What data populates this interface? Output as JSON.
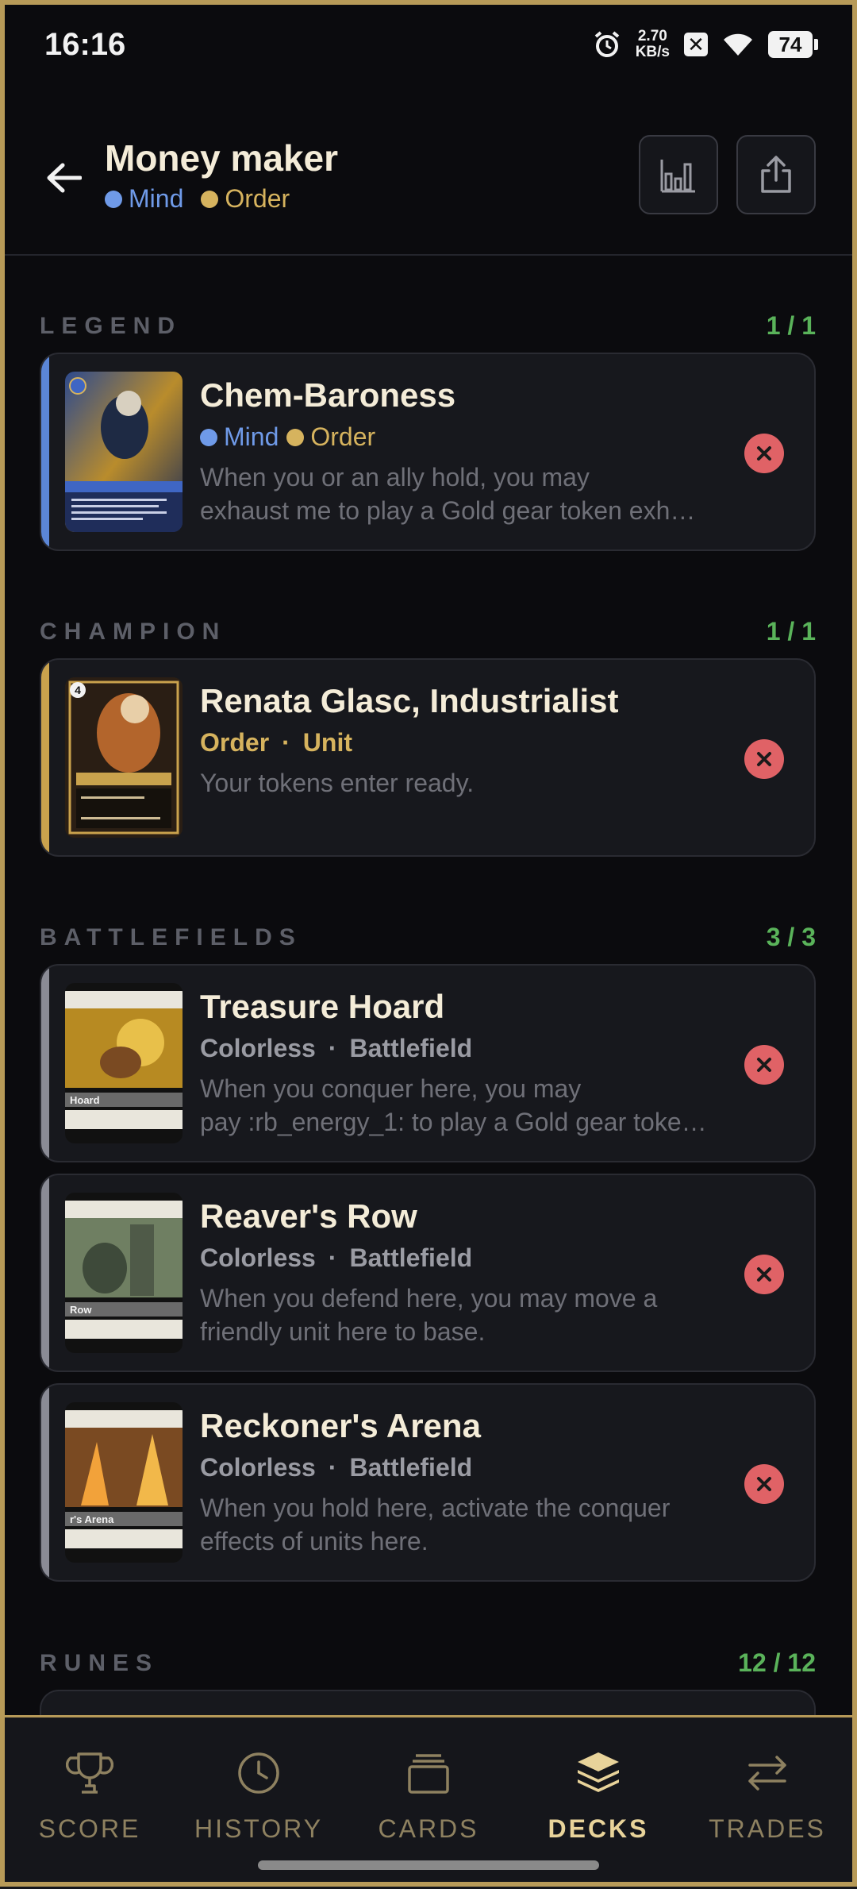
{
  "status_bar": {
    "time": "16:16",
    "net_speed_value": "2.70",
    "net_speed_unit": "KB/s",
    "battery": "74",
    "icons": [
      "alarm-icon",
      "data-saver-icon",
      "wifi-icon",
      "battery-icon"
    ]
  },
  "header": {
    "back_icon": "arrow-left-icon",
    "title": "Money maker",
    "domains": [
      {
        "label": "Mind",
        "color": "#6f9ae8"
      },
      {
        "label": "Order",
        "color": "#d6b35e"
      }
    ],
    "stats_icon": "bar-chart-icon",
    "share_icon": "share-icon"
  },
  "sections": {
    "legend": {
      "title": "LEGEND",
      "count": "1 / 1"
    },
    "champion": {
      "title": "CHAMPION",
      "count": "1 / 1"
    },
    "battlefields": {
      "title": "BATTLEFIELDS",
      "count": "3 / 3"
    },
    "runes": {
      "title": "RUNES",
      "count": "12 / 12"
    }
  },
  "cards": {
    "legend": {
      "name": "Chem-Baroness",
      "domain1": "Mind",
      "domain2": "Order",
      "text1": "When you or an ally hold, you may",
      "text2": "exhaust me to play a Gold gear token exha…",
      "accent": "#5b86d6"
    },
    "champion": {
      "name": "Renata Glasc, Industrialist",
      "domain": "Order",
      "type": "Unit",
      "text1": "Your tokens enter ready.",
      "accent": "#c9a24d"
    },
    "battlefields": [
      {
        "name": "Treasure Hoard",
        "domain": "Colorless",
        "type": "Battlefield",
        "text1": "When you conquer here, you may",
        "text2": "pay :rb_energy_1: to play a Gold gear token…",
        "accent": "#8a8b95"
      },
      {
        "name": "Reaver's Row",
        "domain": "Colorless",
        "type": "Battlefield",
        "text1": "When you defend here, you may move a",
        "text2": "friendly unit here to base.",
        "accent": "#8a8b95"
      },
      {
        "name": "Reckoner's Arena",
        "domain": "Colorless",
        "type": "Battlefield",
        "text1": "When you hold here, activate the conquer",
        "text2": "effects of units here.",
        "accent": "#8a8b95"
      }
    ],
    "separator": "·",
    "remove_icon": "close-icon"
  },
  "thumbnails": {
    "legend_label": "Chem-Baroness",
    "champion_label": "Renata Glasc",
    "champion_cost": "4",
    "bf1_label": "Hoard",
    "bf2_label": "Row",
    "bf3_label": "r's Arena"
  },
  "bottom_nav": {
    "items": [
      {
        "label": "SCORE",
        "icon": "trophy-icon"
      },
      {
        "label": "HISTORY",
        "icon": "clock-icon"
      },
      {
        "label": "CARDS",
        "icon": "card-stack-icon"
      },
      {
        "label": "DECKS",
        "icon": "layers-icon",
        "active": true
      },
      {
        "label": "TRADES",
        "icon": "swap-arrows-icon"
      }
    ]
  },
  "colors": {
    "accent_gold": "#b79a58",
    "count_green": "#5ab35a",
    "remove_red": "#e06266",
    "mind_blue": "#6f9ae8",
    "order_gold": "#d6b35e"
  }
}
